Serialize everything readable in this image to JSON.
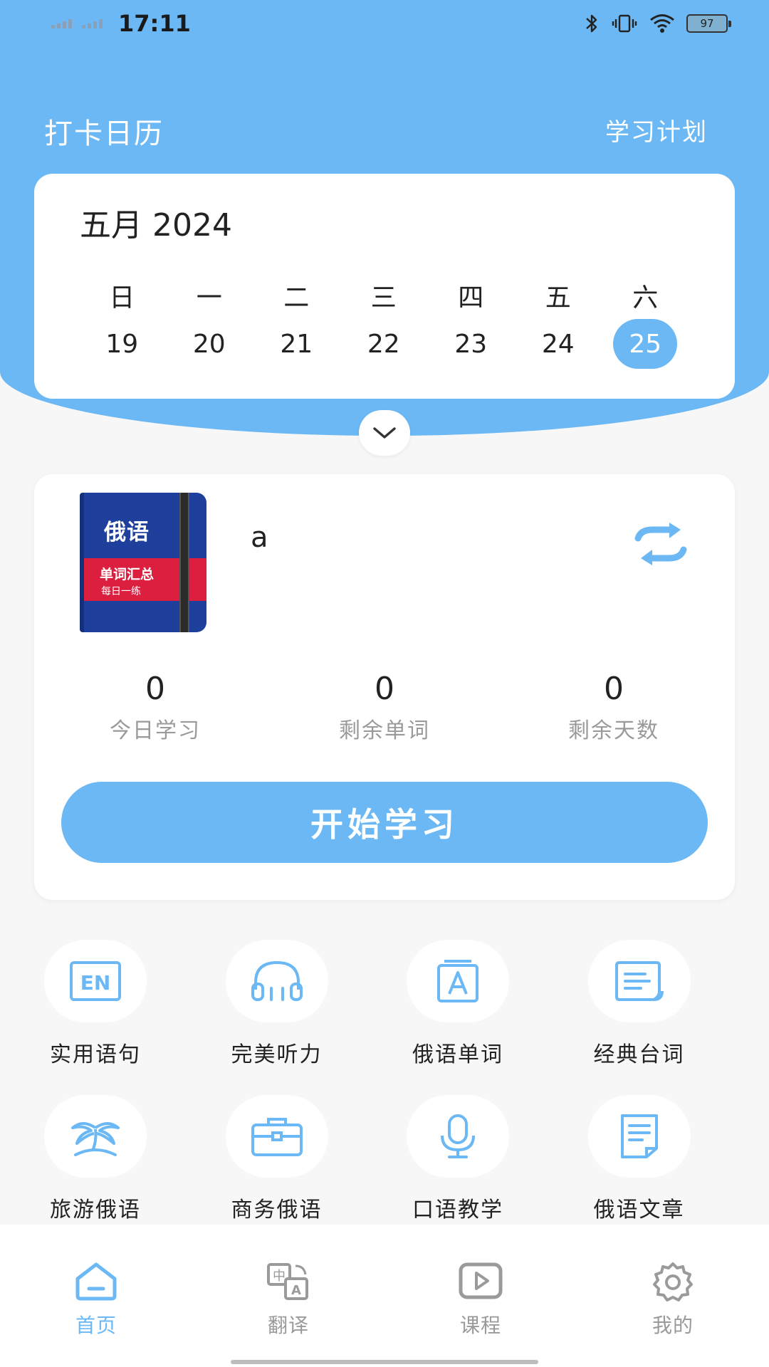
{
  "status_bar": {
    "time": "17:11",
    "battery": "97"
  },
  "header": {
    "title": "打卡日历",
    "plan_link": "学习计划"
  },
  "calendar": {
    "month_label": "五月 2024",
    "weekdays": [
      "日",
      "一",
      "二",
      "三",
      "四",
      "五",
      "六"
    ],
    "days": [
      "19",
      "20",
      "21",
      "22",
      "23",
      "24",
      "25"
    ],
    "selected_day": "25"
  },
  "study": {
    "book": {
      "title": "俄语",
      "subtitle": "单词汇总",
      "tagline": "每日一练"
    },
    "book_name": "a",
    "stats": [
      {
        "value": "0",
        "label": "今日学习"
      },
      {
        "value": "0",
        "label": "剩余单词"
      },
      {
        "value": "0",
        "label": "剩余天数"
      }
    ],
    "start_label": "开始学习"
  },
  "features": [
    {
      "label": "实用语句",
      "icon": "en-icon"
    },
    {
      "label": "完美听力",
      "icon": "headphones-icon"
    },
    {
      "label": "俄语单词",
      "icon": "word-card-icon"
    },
    {
      "label": "经典台词",
      "icon": "script-icon"
    },
    {
      "label": "旅游俄语",
      "icon": "palm-island-icon"
    },
    {
      "label": "商务俄语",
      "icon": "briefcase-icon"
    },
    {
      "label": "口语教学",
      "icon": "microphone-icon"
    },
    {
      "label": "俄语文章",
      "icon": "document-icon"
    }
  ],
  "nav": [
    {
      "label": "首页",
      "icon": "home-icon",
      "active": true
    },
    {
      "label": "翻译",
      "icon": "translate-icon",
      "active": false
    },
    {
      "label": "课程",
      "icon": "video-play-icon",
      "active": false
    },
    {
      "label": "我的",
      "icon": "gear-icon",
      "active": false
    }
  ],
  "colors": {
    "accent": "#6bb8f4",
    "book_blue": "#1e3f9c",
    "book_red": "#dc1f3f",
    "muted_text": "#9a9a9a"
  }
}
